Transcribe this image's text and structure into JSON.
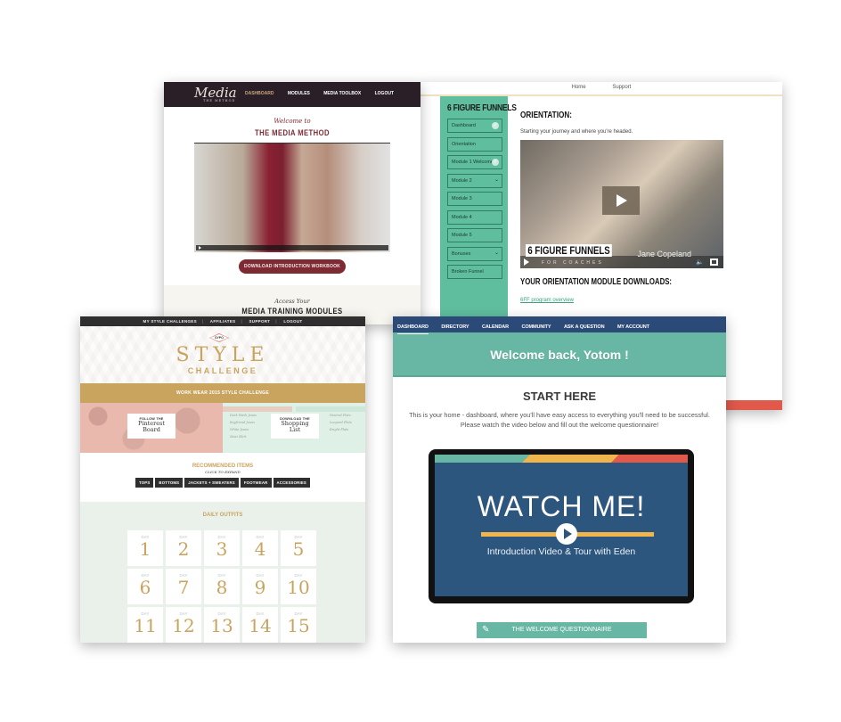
{
  "colors": {
    "media_header": "#2a1f26",
    "media_accent": "#7d2a32",
    "funnels_green": "#5fbe9e",
    "funnels_red_footer": "#e0594b",
    "style_gold": "#c9a45e",
    "style_dark": "#2f2f2f",
    "dash_nav": "#2b4a78",
    "dash_teal": "#68b7a5",
    "video_blue": "#2d567f",
    "video_stripes": [
      "#68b7a5",
      "#f0b54c",
      "#e0594b"
    ]
  },
  "media_method": {
    "logo": "Media",
    "logo_small": "THE METHOD",
    "nav": [
      "DASHBOARD",
      "MODULES",
      "MEDIA TOOLBOX",
      "LOGOUT"
    ],
    "active_nav": "DASHBOARD",
    "welcome": "Welcome to",
    "title": "THE MEDIA METHOD",
    "download_button": "DOWNLOAD INTRODUCTION WORKBOOK",
    "access": "Access Your",
    "modules_heading": "MEDIA TRAINING MODULES"
  },
  "funnels": {
    "topnav": [
      "Home",
      "Support"
    ],
    "sidebar_title": "6 FIGURE FUNNELS",
    "sidebar_items": [
      {
        "label": "Dashboard",
        "state": "complete"
      },
      {
        "label": "Orientation",
        "state": "none"
      },
      {
        "label": "Module 1 Welcome",
        "state": "complete"
      },
      {
        "label": "Module 2",
        "state": "expandable"
      },
      {
        "label": "Module 3",
        "state": "none"
      },
      {
        "label": "Module 4",
        "state": "none"
      },
      {
        "label": "Module 5",
        "state": "none"
      },
      {
        "label": "Bonuses",
        "state": "expandable"
      },
      {
        "label": "Broken Funnel",
        "state": "none"
      }
    ],
    "heading": "ORIENTATION:",
    "subheading": "Starting your journey and where you're headed.",
    "video": {
      "brand": "6 FIGURE FUNNELS",
      "brand_sub": "FOR COACHES",
      "presenter": "Jane Copeland"
    },
    "downloads_heading": "YOUR ORIENTATION MODULE DOWNLOADS:",
    "download_link": "6FF program overview"
  },
  "style_challenge": {
    "topbar": [
      "MY STYLE CHALLENGES",
      "AFFILIATES",
      "SUPPORT",
      "LOGOUT"
    ],
    "badge": "SYPO",
    "title_line1": "STYLE",
    "title_line2": "CHALLENGE",
    "banner": "WORK WEAR 2015 STYLE CHALLENGE",
    "card_pinterest": {
      "small": "FOLLOW THE",
      "big1": "Pinterest",
      "big2": "Board"
    },
    "card_shopping": {
      "small": "DOWNLOAD THE",
      "big1": "Shopping",
      "big2": "List"
    },
    "bottoms_list": [
      "Dark Wash Jeans",
      "Boyfriend Jeans",
      "White Jeans",
      "Maxi Skirt"
    ],
    "shoes_list": [
      "Neutral Flats",
      "Leopard Flats",
      "Bright Flats"
    ],
    "recommended_title": "RECOMMENDED ITEMS",
    "recommended_sub": "CLICK TO EXPAND",
    "categories": [
      "TOPS",
      "BOTTOMS",
      "JACKETS + SWEATERS",
      "FOOTWEAR",
      "ACCESSORIES"
    ],
    "daily_title": "DAILY OUTFITS",
    "day_label": "DAY",
    "days": [
      "1",
      "2",
      "3",
      "4",
      "5",
      "6",
      "7",
      "8",
      "9",
      "10",
      "11",
      "12",
      "13",
      "14",
      "15"
    ]
  },
  "dashboard": {
    "nav": [
      "DASHBOARD",
      "DIRECTORY",
      "CALENDAR",
      "COMMUNITY",
      "ASK A QUESTION",
      "MY ACCOUNT"
    ],
    "active_nav": "DASHBOARD",
    "welcome": "Welcome back, Yotom !",
    "start_heading": "START HERE",
    "intro_line1": "This is your home - dashboard, where you'll have easy access to everything you'll need to be successful.",
    "intro_line2": "Please watch the video below and fill out the welcome questionnaire!",
    "video_title": "WATCH ME!",
    "video_tagline": "Introduction Video & Tour with Eden",
    "questionnaire_button": "THE WELCOME QUESTIONNAIRE",
    "pencil_icon": "✎"
  }
}
